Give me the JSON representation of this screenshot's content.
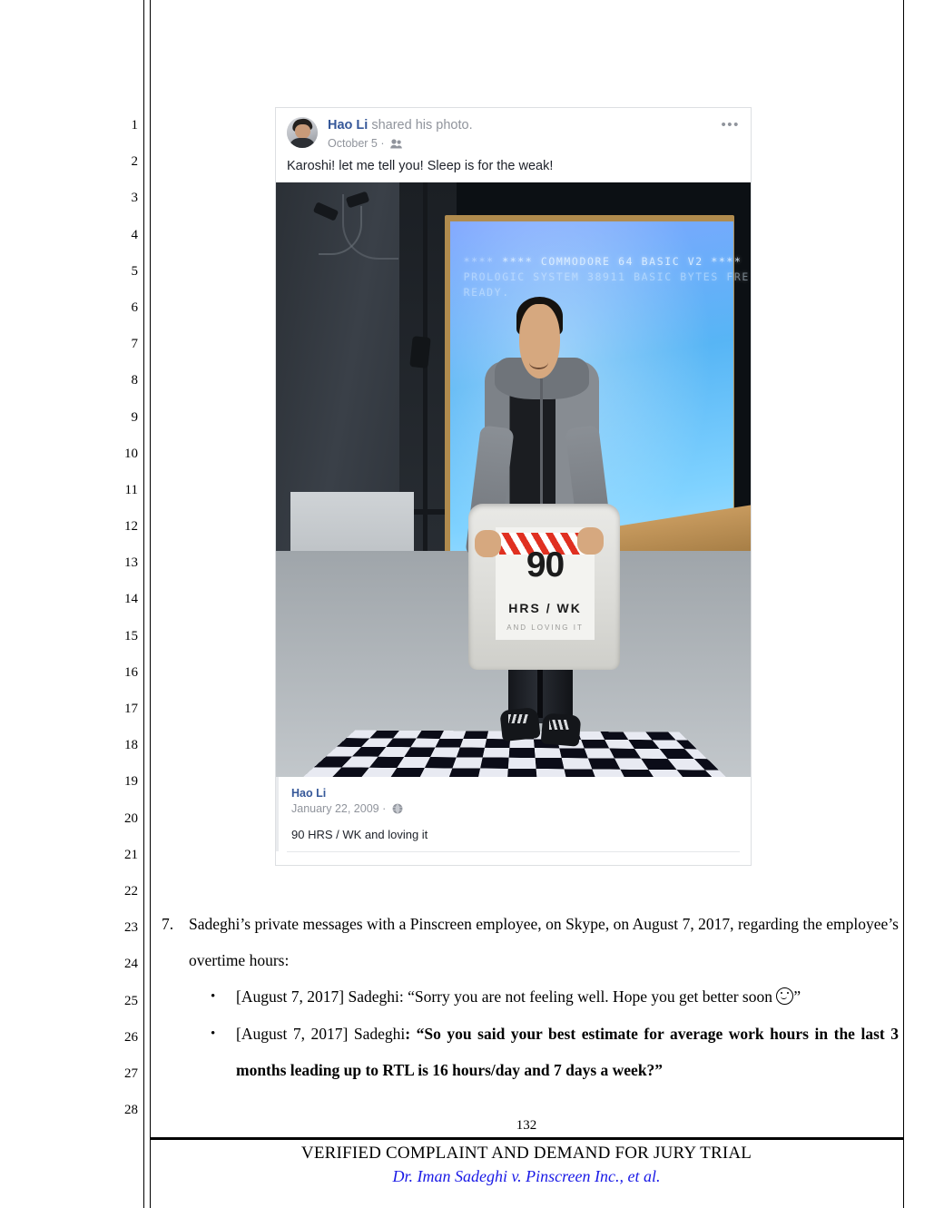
{
  "document": {
    "line_numbers": [
      "1",
      "2",
      "3",
      "4",
      "5",
      "6",
      "7",
      "8",
      "9",
      "10",
      "11",
      "12",
      "13",
      "14",
      "15",
      "16",
      "17",
      "18",
      "19",
      "20",
      "21",
      "22",
      "23",
      "24",
      "25",
      "26",
      "27",
      "28"
    ],
    "page_number": "132",
    "footer_title": "VERIFIED COMPLAINT AND DEMAND FOR JURY TRIAL",
    "footer_case": "Dr. Iman Sadeghi v. Pinscreen Inc., et al."
  },
  "facebook_post": {
    "author": "Hao Li",
    "action": "shared his photo",
    "action_period": ".",
    "date": "October 5",
    "audience_icon": "friends-icon",
    "menu_icon": "ellipsis-icon",
    "message": "Karoshi! let me tell you! Sleep is for the weak!",
    "photo": {
      "alt": "Man holding a grey sweatshirt in front of a projection screen",
      "screen_text_line1": "**** COMMODORE 64 BASIC V2 ****",
      "screen_text_line2": "PROLOGIC SYSTEM 38911 BASIC BYTES FRE",
      "screen_text_line3": "READY.",
      "shirt_number": "90",
      "shirt_line2": "HRS / WK",
      "shirt_line3": "AND LOVING IT"
    },
    "attachment": {
      "author": "Hao Li",
      "date": "January 22, 2009",
      "privacy_icon": "globe-icon",
      "caption": "90 HRS / WK and loving it"
    }
  },
  "body": {
    "item_number": "7.",
    "item_text": "Sadeghi’s private messages with a Pinscreen employee, on Skype, on August 7, 2017, regarding the employee’s overtime hours:",
    "bullets": [
      {
        "marker": "•",
        "lead": "[August 7, 2017] Sadeghi: “Sorry you are not feeling well. Hope you get better soon ",
        "emoji_icon": "smiley-face-icon",
        "trail": "”",
        "bold": false
      },
      {
        "marker": "•",
        "lead": "[August 7, 2017] Sadeghi",
        "quote": ": “So you said your best estimate for average work hours in the last 3 months leading up to RTL is 16 hours/day and 7 days a week?”",
        "bold": true
      }
    ]
  }
}
